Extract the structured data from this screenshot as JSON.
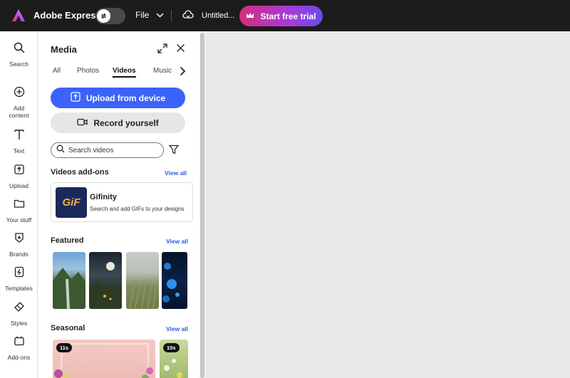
{
  "topbar": {
    "app_name": "Adobe Express",
    "file_label": "File",
    "doc_title": "Untitled...",
    "trial_label": "Start free trial"
  },
  "rail": {
    "items": [
      {
        "label": "Search",
        "icon": "search-icon"
      },
      {
        "label": "Add content",
        "icon": "plus-circle-icon"
      },
      {
        "label": "Text",
        "icon": "text-icon"
      },
      {
        "label": "Upload",
        "icon": "upload-icon"
      },
      {
        "label": "Your stuff",
        "icon": "folder-icon"
      },
      {
        "label": "Brands",
        "icon": "brands-icon"
      },
      {
        "label": "Templates",
        "icon": "templates-icon"
      },
      {
        "label": "Styles",
        "icon": "styles-icon"
      },
      {
        "label": "Add-ons",
        "icon": "add-ons-icon"
      }
    ]
  },
  "panel": {
    "title": "Media",
    "tabs": [
      "All",
      "Photos",
      "Videos",
      "Music"
    ],
    "active_tab": "Videos",
    "upload_label": "Upload from device",
    "record_label": "Record yourself",
    "search_placeholder": "Search videos",
    "addons_title": "Videos add-ons",
    "featured_title": "Featured",
    "seasonal_title": "Seasonal",
    "view_all": "View all",
    "addon": {
      "name": "Gifinity",
      "desc": "Search and add GIFs to your designs",
      "thumb_text": "GiF"
    },
    "seasonal": [
      {
        "duration": "11s"
      },
      {
        "duration": "10s"
      }
    ]
  },
  "colors": {
    "topbar_bg": "#1c1c1c",
    "accent_blue": "#3b63fb",
    "trial_gradient_start": "#d42f7a",
    "trial_gradient_end": "#6a4be8",
    "canvas_bg": "#e9e9e9"
  }
}
